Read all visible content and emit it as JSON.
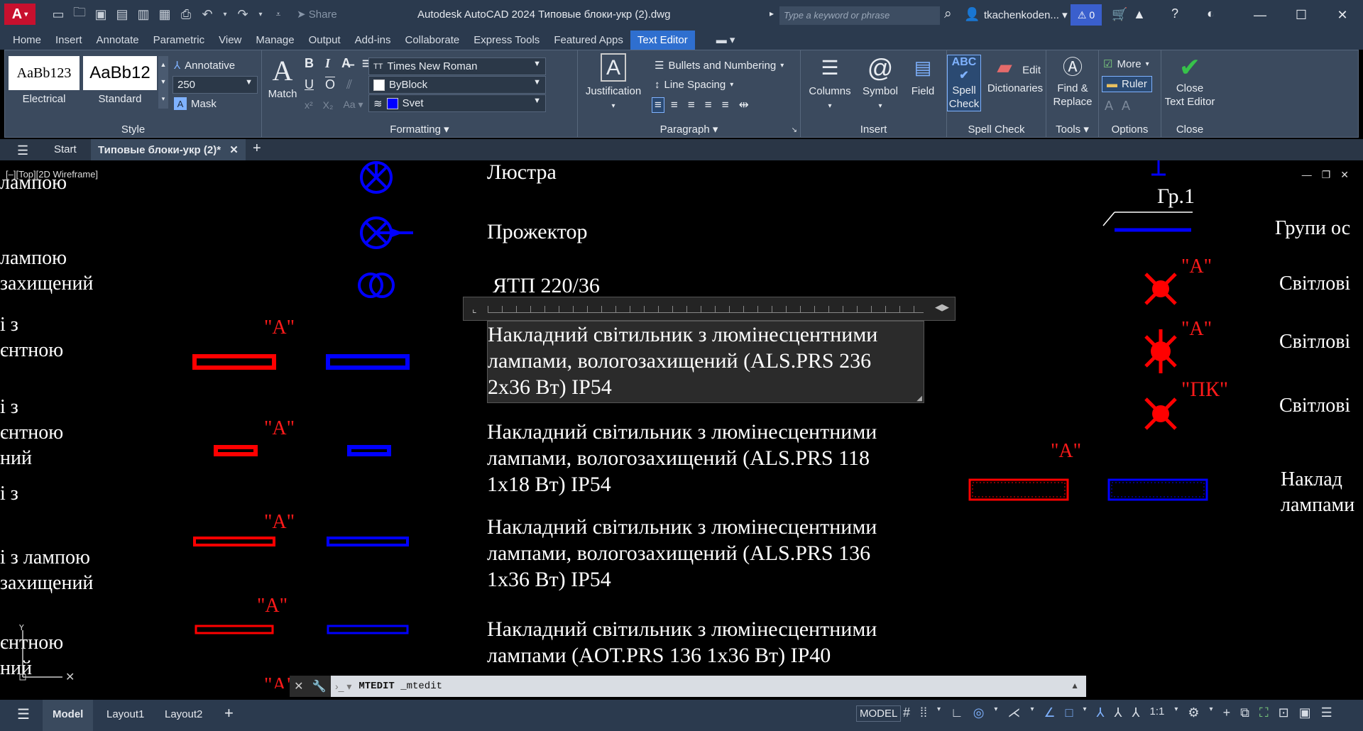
{
  "titlebar": {
    "app_title": "Autodesk AutoCAD 2024    Типовые блоки-укр (2).dwg",
    "share_label": "Share",
    "search_placeholder": "Type a keyword or phrase",
    "user": "tkachenkoden...",
    "alerts_count": "0",
    "logo_letter": "A"
  },
  "ribbon_tabs": [
    "Home",
    "Insert",
    "Annotate",
    "Parametric",
    "View",
    "Manage",
    "Output",
    "Add-ins",
    "Collaborate",
    "Express Tools",
    "Featured Apps",
    "Text Editor"
  ],
  "active_tab": "Text Editor",
  "ribbon": {
    "style": {
      "styles": [
        {
          "sample": "AaBb123",
          "name": "Electrical"
        },
        {
          "sample": "AaBb12",
          "name": "Standard"
        }
      ],
      "annotative_label": "Annotative",
      "height_value": "250",
      "mask_label": "Mask",
      "panel_label": "Style"
    },
    "formatting": {
      "match_label": "Match",
      "bold": "B",
      "italic": "I",
      "underline": "U",
      "overline": "O",
      "font_value": "Times New Roman",
      "color_value": "ByBlock",
      "layer_value": "Svet",
      "layer_color": "#0000ff",
      "panel_label": "Formatting"
    },
    "paragraph": {
      "justification_label": "Justification",
      "bullets_label": "Bullets and Numbering",
      "line_spacing_label": "Line Spacing",
      "panel_label": "Paragraph"
    },
    "insert": {
      "columns_label": "Columns",
      "symbol_label": "Symbol",
      "field_label": "Field",
      "panel_label": "Insert"
    },
    "spell": {
      "spell_check_line1": "Spell",
      "spell_check_line2": "Check",
      "edit_dict_line1": "Edit",
      "edit_dict_line2": "Dictionaries",
      "panel_label": "Spell Check"
    },
    "tools": {
      "find_line1": "Find &",
      "find_line2": "Replace",
      "panel_label": "Tools"
    },
    "options": {
      "more_label": "More",
      "ruler_label": "Ruler",
      "panel_label": "Options"
    },
    "close": {
      "close_line1": "Close",
      "close_line2": "Text Editor",
      "panel_label": "Close"
    }
  },
  "file_tabs": {
    "start": "Start",
    "active_file": "Типовые блоки-укр (2)*"
  },
  "viewport_label": "[–][Top][2D Wireframe]",
  "canvas_text": {
    "left_col": [
      "лампою",
      "лампою",
      "захищений",
      "і з",
      "єнтною",
      "і з",
      "єнтною",
      "ний",
      "і з",
      "і з лампою",
      "захищений",
      "єнтною",
      "ний"
    ],
    "lustra": "Люстра",
    "projector": "Прожектор",
    "yatp": "ЯТП 220/36",
    "editing_lines": [
      "Накладний світильник з люмінесцентними",
      "лампами, вологозахищений (ALS.PRS 236",
      "2х36 Вт) IP54"
    ],
    "block2": [
      "Накладний світильник з люмінесцентними",
      "лампами, вологозахищений (ALS.PRS 118",
      "1х18 Вт) IP54"
    ],
    "block3": [
      "Накладний світильник з люмінесцентними",
      "лампами, вологозахищений (ALS.PRS 136",
      "1х36 Вт) IP54"
    ],
    "block4": [
      "Накладний світильник з люмінесцентними",
      "лампами (AOT.PRS 136 1х36 Вт) IP40"
    ],
    "marker_a": "\"А\"",
    "marker_pk": "\"ПК\"",
    "group": "Гр.1",
    "right_col": [
      "Групи ос",
      "Світлові",
      "Світлові",
      "Світлові",
      "Наклад",
      "лампами"
    ]
  },
  "command_line": {
    "command": "MTEDIT",
    "echo": "_mtedit"
  },
  "statusbar": {
    "tabs": [
      "Model",
      "Layout1",
      "Layout2"
    ],
    "model_label": "MODEL",
    "scale": "1:1"
  }
}
